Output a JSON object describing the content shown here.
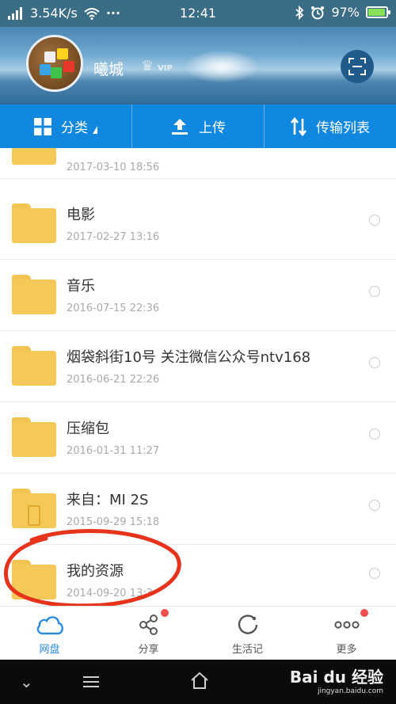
{
  "status_bar": {
    "network_speed": "3.54K/s",
    "dots": "···",
    "time": "12:41",
    "battery": "97%",
    "battery_level": 0.97
  },
  "header": {
    "username": "曦城",
    "vip": "VIP"
  },
  "toolbar": {
    "category_label": "分类",
    "upload_label": "上传",
    "transfer_label": "传输列表"
  },
  "files": [
    {
      "name": "",
      "date": "2017-03-10  18:56"
    },
    {
      "name": "电影",
      "date": "2017-02-27  13:16"
    },
    {
      "name": "音乐",
      "date": "2016-07-15  22:36"
    },
    {
      "name": "烟袋斜街10号 关注微信公众号ntv168",
      "date": "2016-06-21  22:26"
    },
    {
      "name": "压缩包",
      "date": "2016-01-31  11:27"
    },
    {
      "name": "来自：MI 2S",
      "date": "2015-09-29  15:18"
    },
    {
      "name": "我的资源",
      "date": "2014-09-20  13:3"
    }
  ],
  "bottom_nav": {
    "items": [
      {
        "label": "网盘",
        "icon": "cloud-icon",
        "active": true
      },
      {
        "label": "分享",
        "icon": "share-icon",
        "active": false
      },
      {
        "label": "生活记",
        "icon": "circle-icon",
        "active": false
      },
      {
        "label": "更多",
        "icon": "more-icon",
        "active": false
      }
    ]
  },
  "watermark": {
    "brand": "Bai du 经验",
    "url": "jingyan.baidu.com"
  },
  "colors": {
    "accent": "#1188e0",
    "folder": "#f5c957",
    "annotation": "#e8331c",
    "badge": "#f05050"
  }
}
